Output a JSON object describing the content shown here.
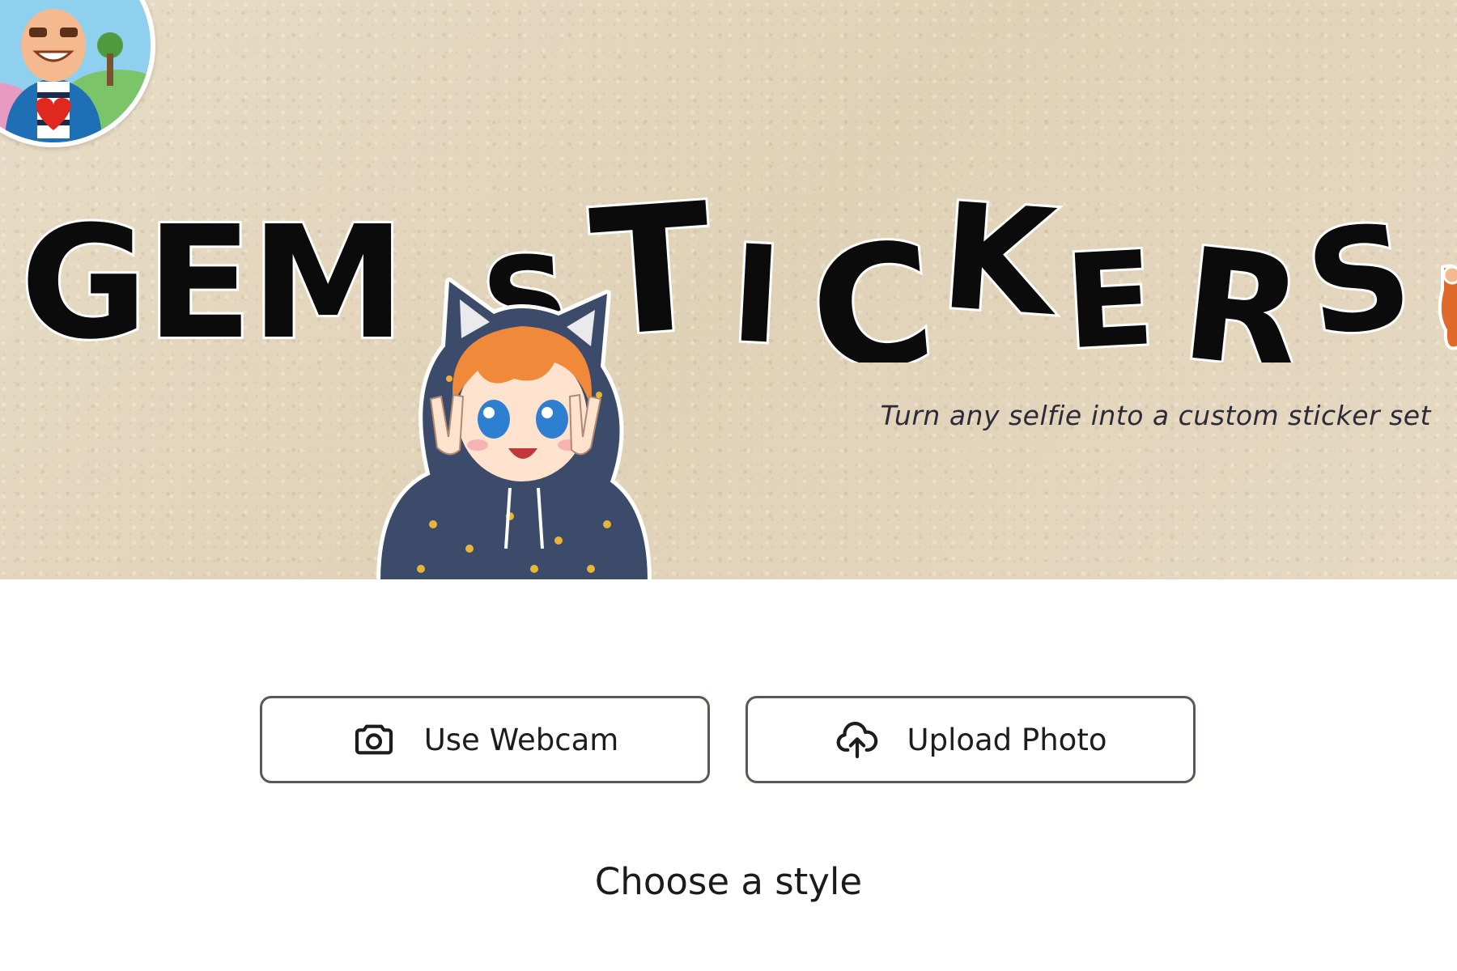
{
  "hero": {
    "title_word1": "GEM",
    "title_word2_letters": [
      "S",
      "T",
      "I",
      "C",
      "K",
      "E",
      "R",
      "S"
    ],
    "tagline": "Turn any selfie into a custom sticker set"
  },
  "actions": {
    "webcam_label": "Use Webcam",
    "webcam_icon": "camera-icon",
    "upload_label": "Upload Photo",
    "upload_icon": "cloud-upload-icon"
  },
  "style_section": {
    "heading": "Choose a style"
  },
  "colors": {
    "hero_background": "#e4d7bf",
    "title_text": "#0b0b0b",
    "button_border": "#5e5653",
    "text": "#1d1d1f",
    "mascot_hoodie": "#3d4b6b",
    "mascot_hair": "#f08a3a"
  }
}
